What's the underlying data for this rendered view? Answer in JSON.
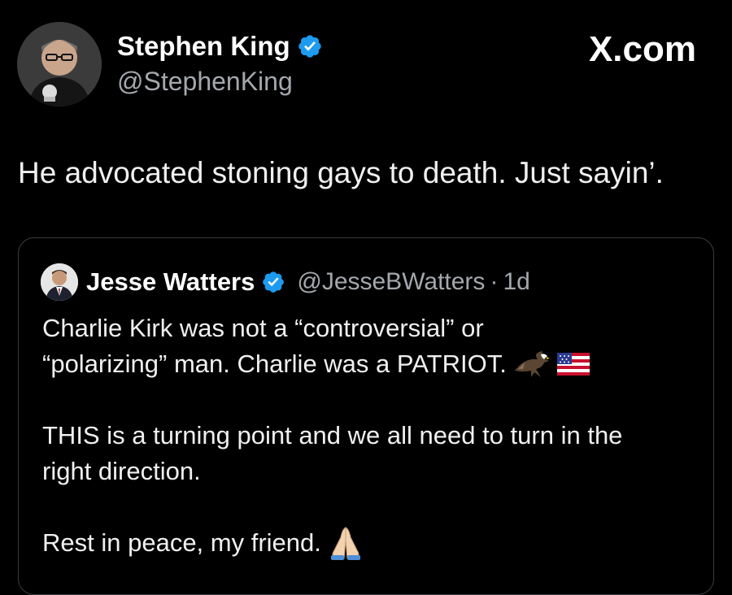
{
  "author": {
    "name": "Stephen King",
    "handle": "@StephenKing"
  },
  "site": {
    "logo_text": "X.com"
  },
  "tweet": {
    "text": "He advocated stoning gays to death. Just sayin’."
  },
  "quote": {
    "name": "Jesse Watters",
    "handle": "@JesseBWatters",
    "separator": "·",
    "time": "1d",
    "line1": "Charlie Kirk was not a “controversial” or",
    "line2": "“polarizing” man. Charlie was a PATRIOT.",
    "line3": "THIS is a turning point and we all need to turn in the",
    "line4": "right direction.",
    "line5": "Rest in peace, my friend."
  },
  "icons": {
    "verified": "verified-badge-icon",
    "eagle": "eagle-emoji-icon",
    "flag": "us-flag-emoji-icon",
    "hands": "folded-hands-emoji-icon"
  },
  "colors": {
    "background": "#000000",
    "text": "#e7e9ea",
    "secondary_text": "#a4a8ad",
    "verified_blue": "#1d9bf0",
    "card_border": "#3a3d42"
  }
}
